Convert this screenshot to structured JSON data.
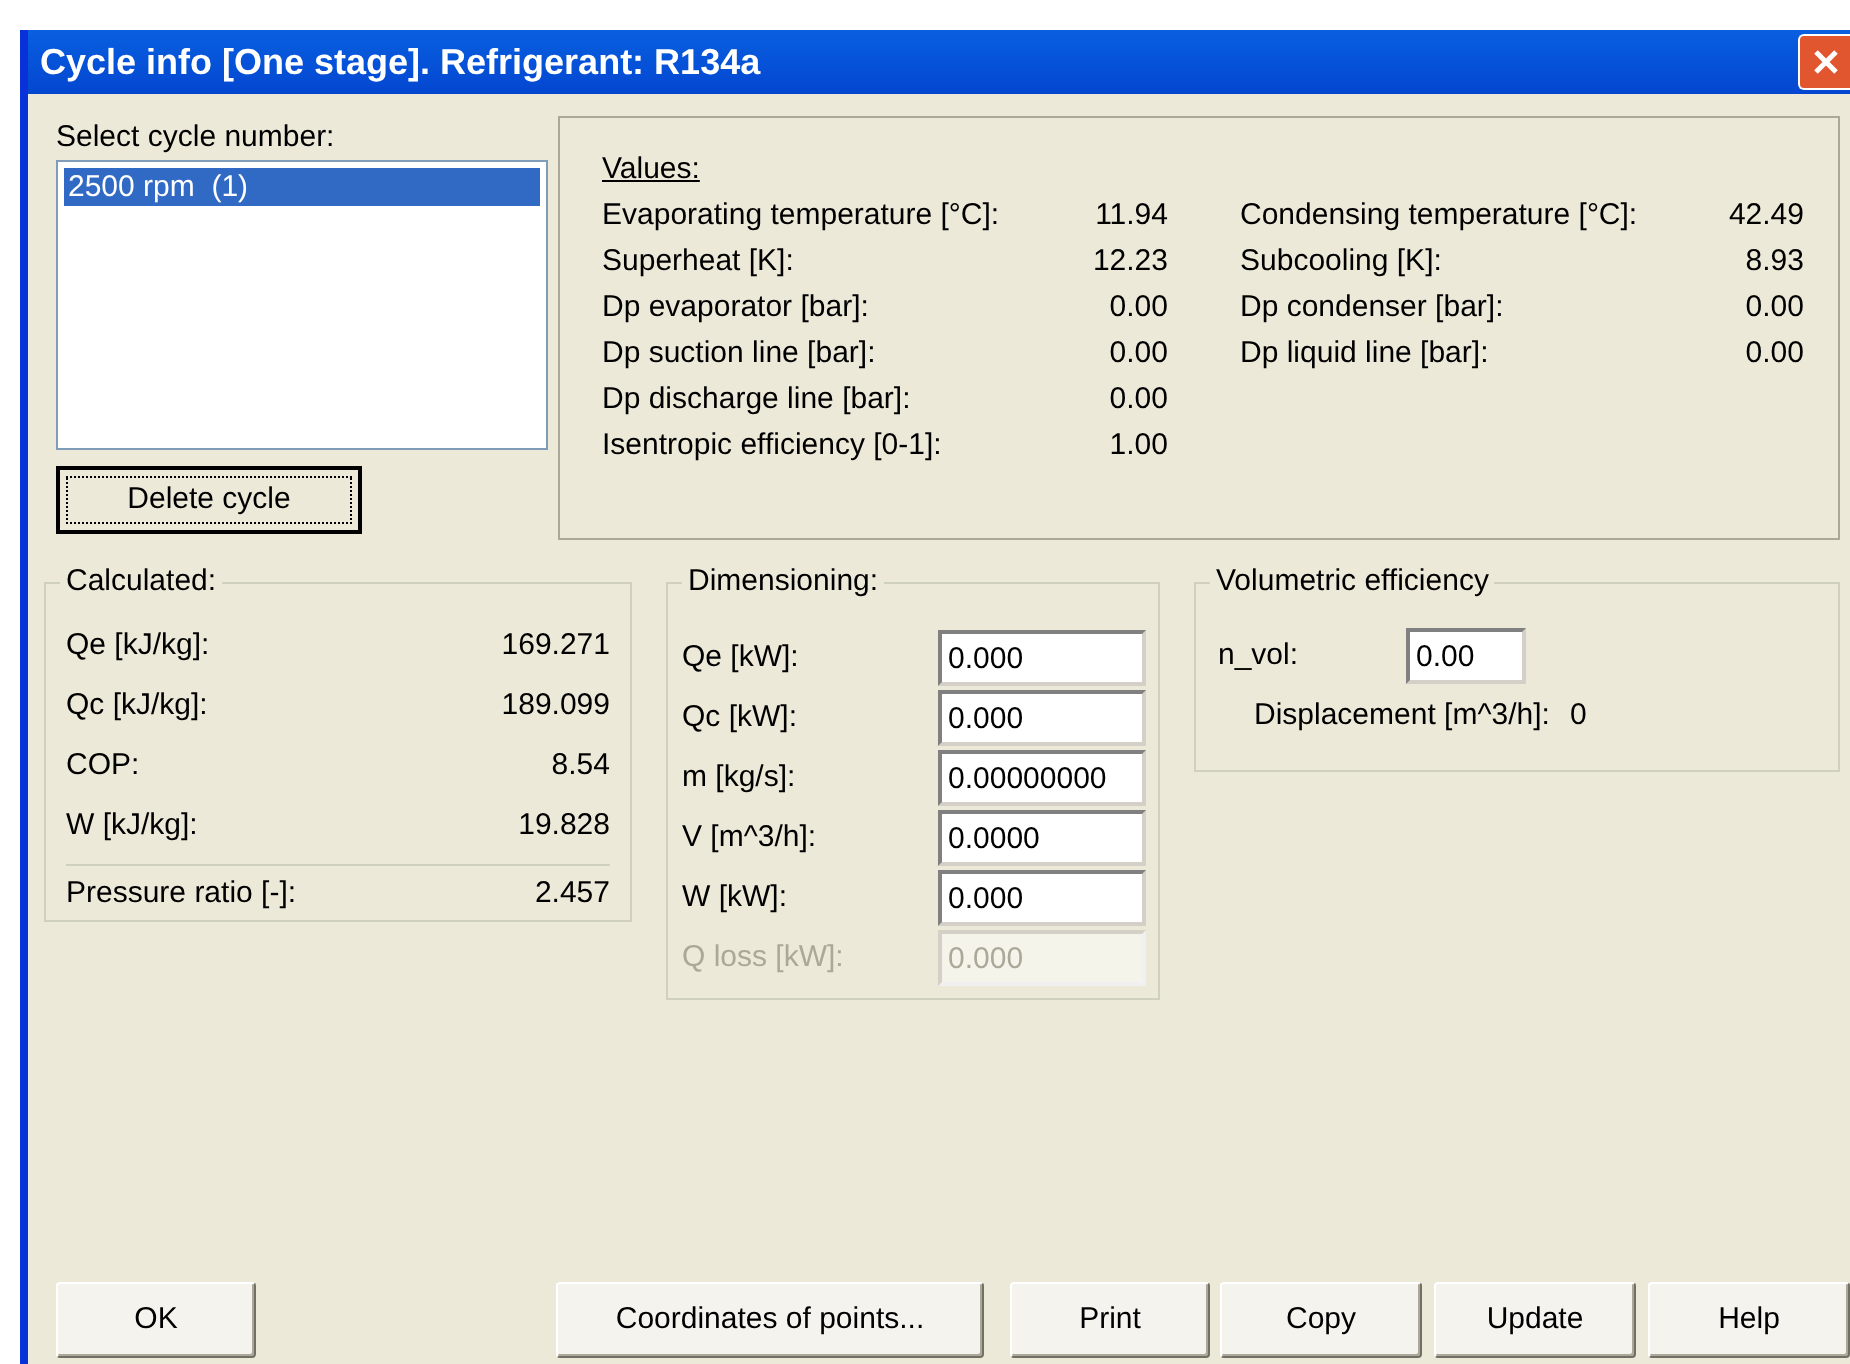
{
  "window": {
    "title": "Cycle info [One stage]. Refrigerant: R134a"
  },
  "cycle_list": {
    "label": "Select cycle number:",
    "items": [
      {
        "text": "2500 rpm  (1)",
        "selected": true
      }
    ]
  },
  "delete_button": "Delete cycle",
  "values": {
    "heading": "Values:",
    "left": [
      {
        "label": "Evaporating temperature [°C]:",
        "value": "11.94"
      },
      {
        "label": "Superheat [K]:",
        "value": "12.23"
      },
      {
        "label": "Dp evaporator [bar]:",
        "value": "0.00"
      },
      {
        "label": "Dp suction line [bar]:",
        "value": "0.00"
      },
      {
        "label": "Dp discharge line [bar]:",
        "value": "0.00"
      },
      {
        "label": "Isentropic efficiency [0-1]:",
        "value": "1.00"
      }
    ],
    "right": [
      {
        "label": "Condensing temperature [°C]:",
        "value": "42.49"
      },
      {
        "label": "Subcooling [K]:",
        "value": "8.93"
      },
      {
        "label": "Dp condenser [bar]:",
        "value": "0.00"
      },
      {
        "label": "Dp liquid line [bar]:",
        "value": "0.00"
      }
    ]
  },
  "calculated": {
    "title": "Calculated:",
    "rows": [
      {
        "label": "Qe [kJ/kg]:",
        "value": "169.271"
      },
      {
        "label": "Qc [kJ/kg]:",
        "value": "189.099"
      },
      {
        "label": "COP:",
        "value": "8.54"
      },
      {
        "label": "W [kJ/kg]:",
        "value": "19.828"
      }
    ],
    "summary": {
      "label": "Pressure ratio [-]:",
      "value": "2.457"
    }
  },
  "dimensioning": {
    "title": "Dimensioning:",
    "fields": [
      {
        "label": "Qe [kW]:",
        "value": "0.000",
        "disabled": false
      },
      {
        "label": "Qc [kW]:",
        "value": "0.000",
        "disabled": false
      },
      {
        "label": "m [kg/s]:",
        "value": "0.00000000",
        "disabled": false
      },
      {
        "label": "V [m^3/h]:",
        "value": "0.0000",
        "disabled": false
      },
      {
        "label": "W [kW]:",
        "value": "0.000",
        "disabled": false
      },
      {
        "label": "Q loss [kW]:",
        "value": "0.000",
        "disabled": true
      }
    ]
  },
  "volumetric": {
    "title": "Volumetric efficiency",
    "field": {
      "label": "n_vol:",
      "value": "0.00"
    },
    "displacement": {
      "label": "Displacement [m^3/h]:",
      "value": "0"
    }
  },
  "buttons": [
    "OK",
    "Coordinates of points...",
    "Print",
    "Copy",
    "Update",
    "Help"
  ]
}
